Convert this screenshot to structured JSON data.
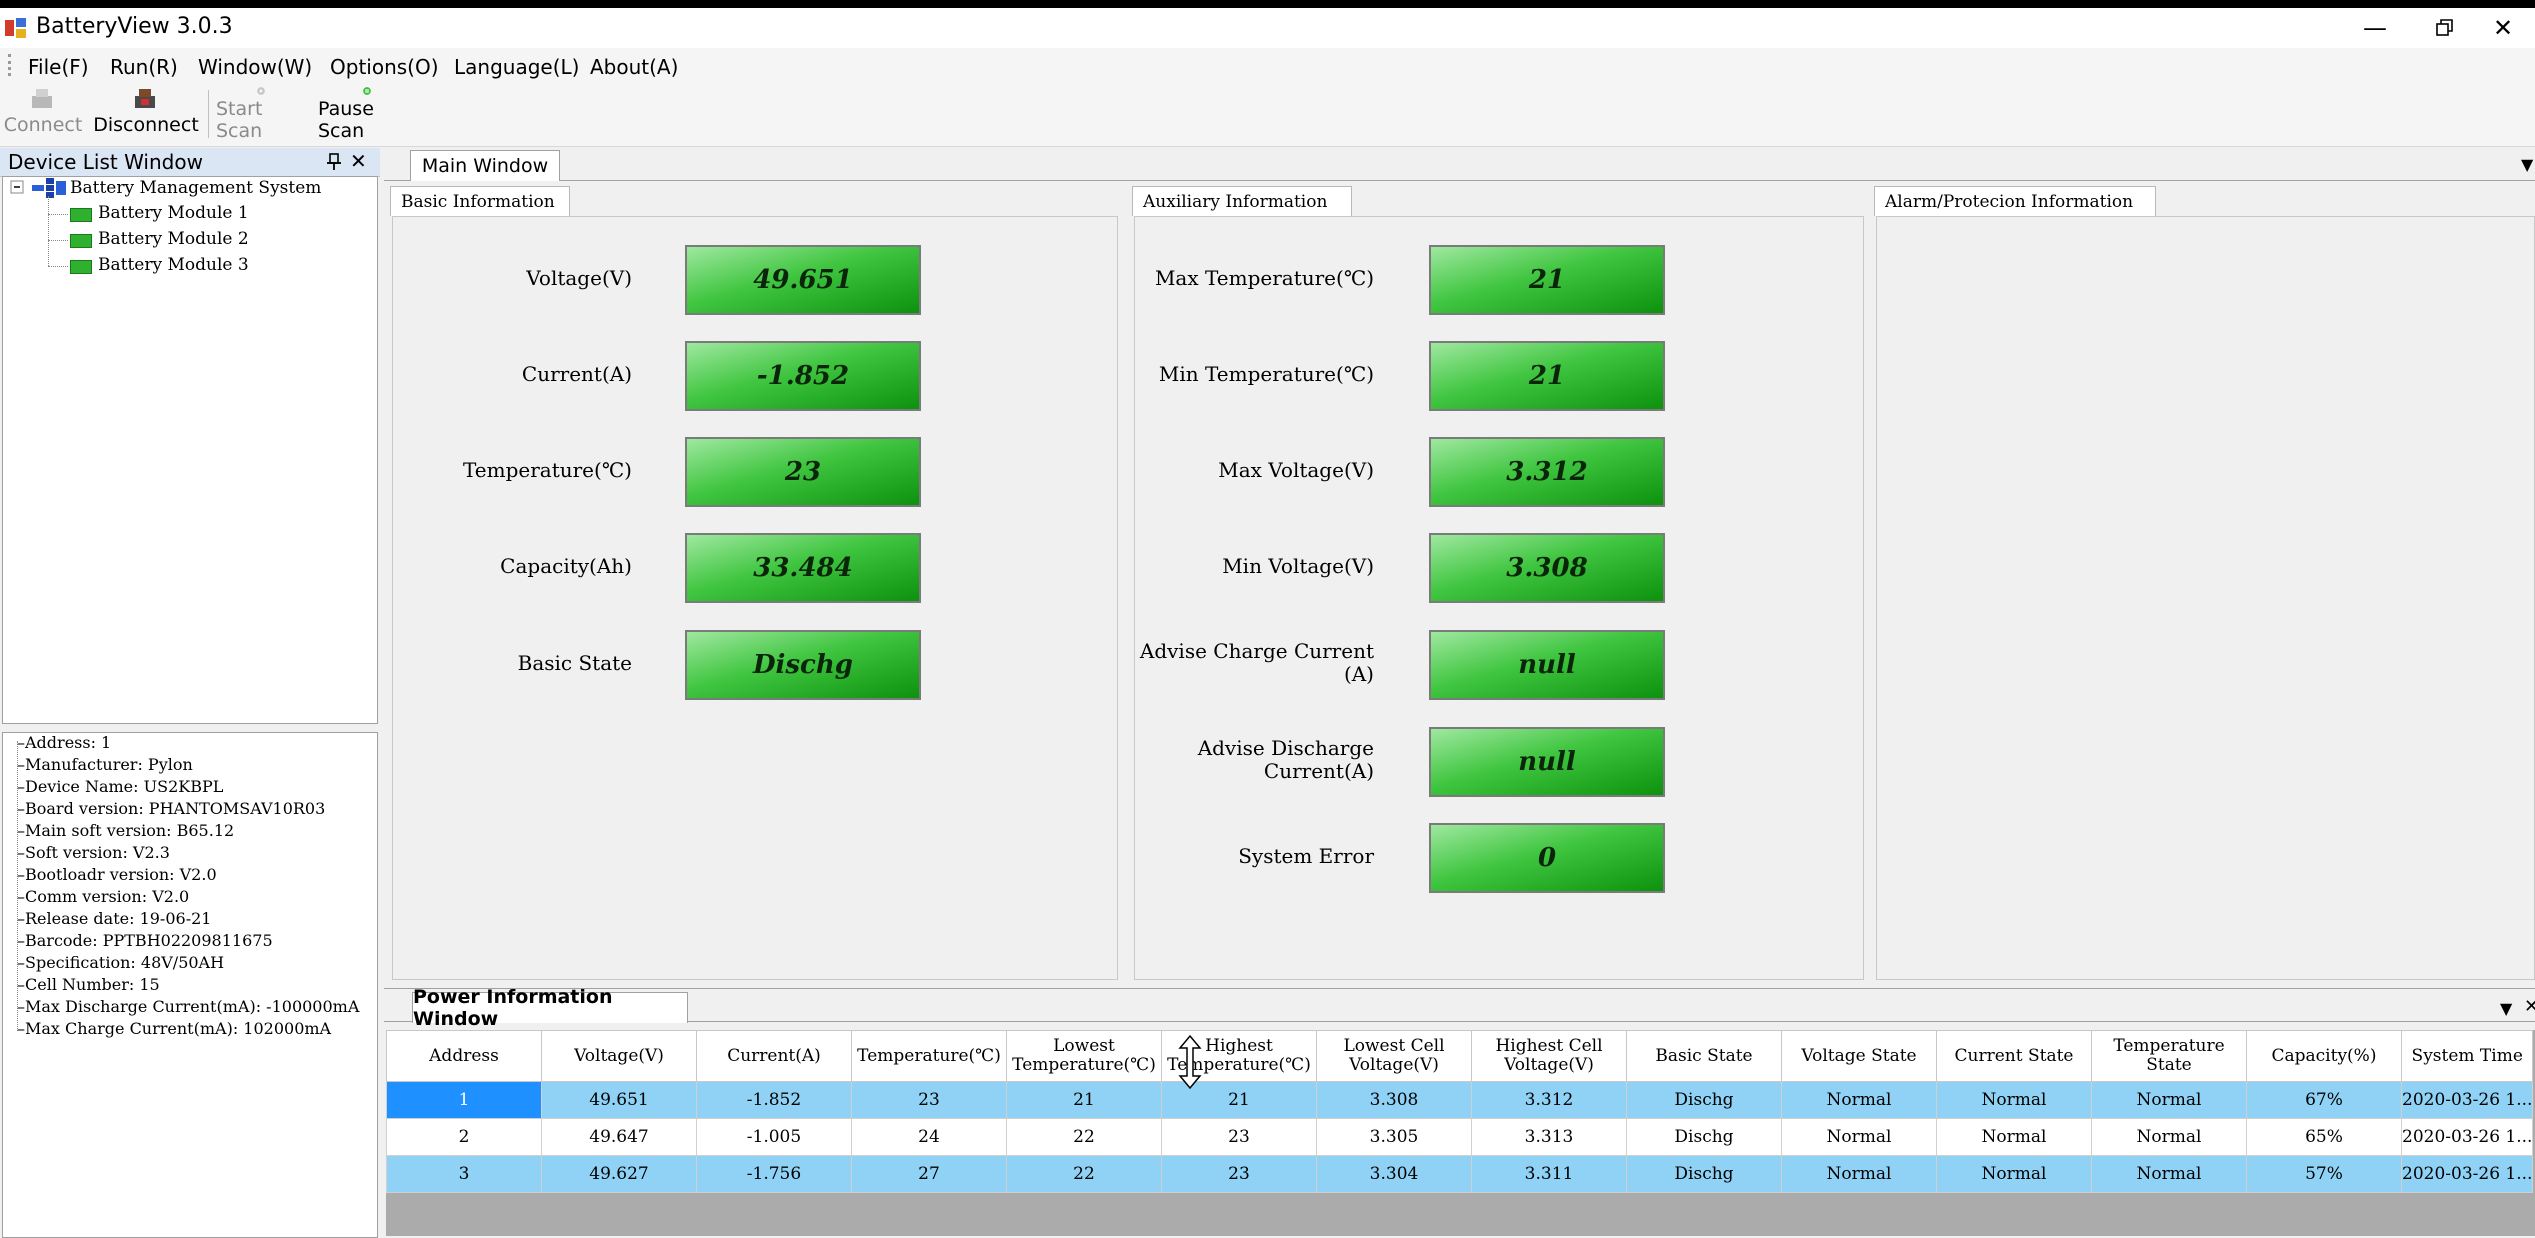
{
  "app": {
    "title": "BatteryView 3.0.3"
  },
  "menu": [
    "File(F)",
    "Run(R)",
    "Window(W)",
    "Options(O)",
    "Language(L)",
    "About(A)"
  ],
  "toolbar": {
    "connect": "Connect",
    "disconnect": "Disconnect",
    "start_scan": "Start Scan",
    "pause_scan": "Pause Scan"
  },
  "device_list": {
    "title": "Device List Window",
    "root": "Battery Management System",
    "modules": [
      "Battery Module 1",
      "Battery Module 2",
      "Battery Module 3"
    ]
  },
  "device_info": [
    "Address: 1",
    "Manufacturer: Pylon",
    "Device Name: US2KBPL",
    "Board version: PHANTOMSAV10R03",
    "Main soft version: B65.12",
    "Soft version: V2.3",
    "Bootloadr version: V2.0",
    "Comm version: V2.0",
    "Release date: 19-06-21",
    "Barcode: PPTBH02209811675",
    "Specification: 48V/50AH",
    "Cell Number: 15",
    "Max Discharge Current(mA): -100000mA",
    "Max Charge Current(mA): 102000mA"
  ],
  "main_window": {
    "tab": "Main Window",
    "basic": {
      "title": "Basic Information",
      "fields": [
        {
          "label": "Voltage(V)",
          "value": "49.651"
        },
        {
          "label": "Current(A)",
          "value": "-1.852"
        },
        {
          "label": "Temperature(℃)",
          "value": "23"
        },
        {
          "label": "Capacity(Ah)",
          "value": "33.484"
        },
        {
          "label": "Basic State",
          "value": "Dischg"
        }
      ]
    },
    "aux": {
      "title": "Auxiliary Information",
      "fields": [
        {
          "label": "Max Temperature(℃)",
          "value": "21"
        },
        {
          "label": "Min Temperature(℃)",
          "value": "21"
        },
        {
          "label": "Max Voltage(V)",
          "value": "3.312"
        },
        {
          "label": "Min Voltage(V)",
          "value": "3.308"
        },
        {
          "label": "Advise Charge Current",
          "label2": "(A)",
          "value": "null"
        },
        {
          "label": "Advise Discharge",
          "label2": "Current(A)",
          "value": "null"
        },
        {
          "label": "System Error",
          "value": "0"
        }
      ]
    },
    "alarm": {
      "title": "Alarm/Protecion Information"
    }
  },
  "power_window": {
    "tab": "Power Information Window",
    "columns": [
      [
        "Address"
      ],
      [
        "Voltage(V)"
      ],
      [
        "Current(A)"
      ],
      [
        "Temperature(℃)"
      ],
      [
        "Lowest",
        "Temperature(℃)"
      ],
      [
        "Highest",
        "Temperature(℃)"
      ],
      [
        "Lowest Cell",
        "Voltage(V)"
      ],
      [
        "Highest Cell",
        "Voltage(V)"
      ],
      [
        "Basic State"
      ],
      [
        "Voltage State"
      ],
      [
        "Current State"
      ],
      [
        "Temperature",
        "State"
      ],
      [
        "Capacity(%)"
      ],
      [
        "System Time"
      ]
    ],
    "rows": [
      [
        "1",
        "49.651",
        "-1.852",
        "23",
        "21",
        "21",
        "3.308",
        "3.312",
        "Dischg",
        "Normal",
        "Normal",
        "Normal",
        "67%",
        "2020-03-26 1..."
      ],
      [
        "2",
        "49.647",
        "-1.005",
        "24",
        "22",
        "23",
        "3.305",
        "3.313",
        "Dischg",
        "Normal",
        "Normal",
        "Normal",
        "65%",
        "2020-03-26 1..."
      ],
      [
        "3",
        "49.627",
        "-1.756",
        "27",
        "22",
        "23",
        "3.304",
        "3.311",
        "Dischg",
        "Normal",
        "Normal",
        "Normal",
        "57%",
        "2020-03-26 1..."
      ]
    ]
  },
  "colors": {
    "value_green": "#22b022",
    "row_blue": "#8fd2f5",
    "selected": "#1e90ff"
  },
  "icons": [
    "app-icon",
    "minimize-icon",
    "restore-icon",
    "close-icon",
    "connect-icon",
    "disconnect-icon",
    "play-icon",
    "pause-icon",
    "pin-icon",
    "tree-collapse-icon",
    "module-icon"
  ]
}
